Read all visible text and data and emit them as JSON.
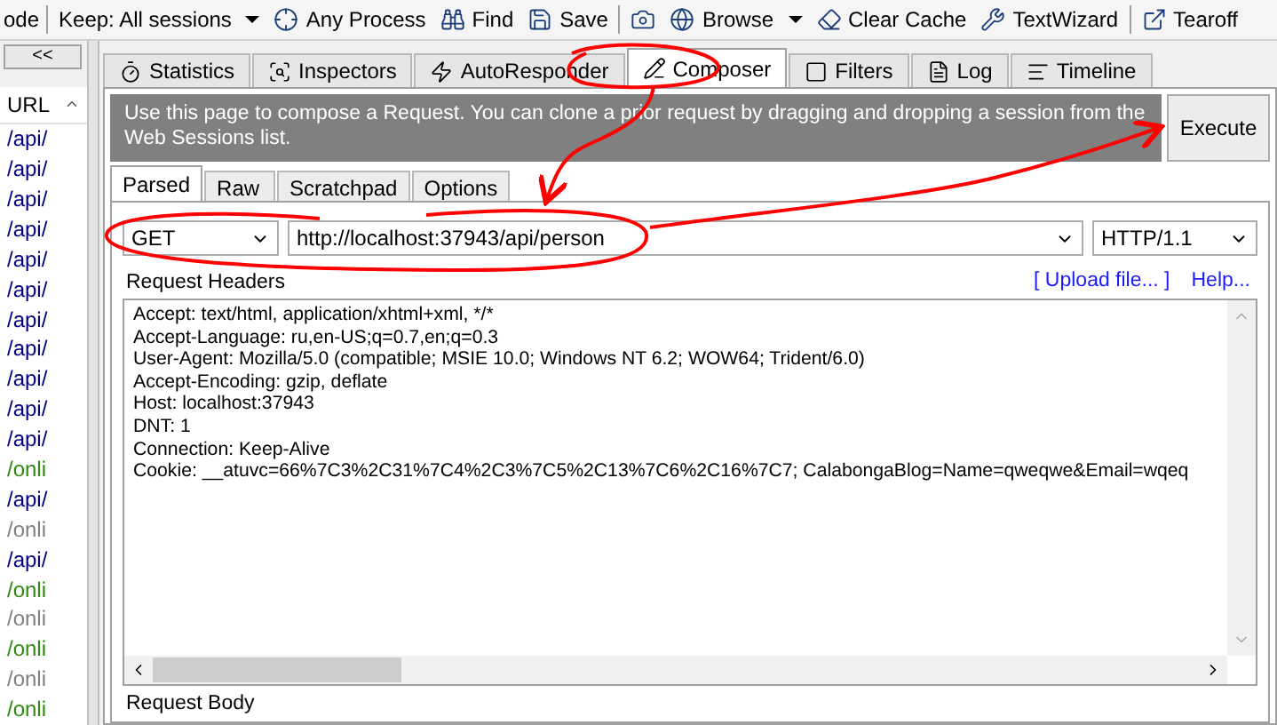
{
  "toolbar": {
    "items": [
      {
        "kind": "text",
        "label": "ode"
      },
      {
        "kind": "separator"
      },
      {
        "kind": "dropdown",
        "label": "Keep: All sessions"
      },
      {
        "kind": "button",
        "label": "Any Process"
      },
      {
        "kind": "button",
        "label": "Find"
      },
      {
        "kind": "button",
        "label": "Save"
      },
      {
        "kind": "separator"
      },
      {
        "kind": "icon-button"
      },
      {
        "kind": "dropdown",
        "label": "Browse"
      },
      {
        "kind": "button",
        "label": "Clear Cache"
      },
      {
        "kind": "button",
        "label": "TextWizard"
      },
      {
        "kind": "separator"
      },
      {
        "kind": "button",
        "label": "Tearoff"
      }
    ]
  },
  "sessions": {
    "collapse_button": "<<",
    "column": "URL",
    "rows": [
      {
        "url": "/api/",
        "color": "#000080"
      },
      {
        "url": "/api/",
        "color": "#000080"
      },
      {
        "url": "/api/",
        "color": "#000080"
      },
      {
        "url": "/api/",
        "color": "#000080"
      },
      {
        "url": "/api/",
        "color": "#000080"
      },
      {
        "url": "/api/",
        "color": "#000080"
      },
      {
        "url": "/api/",
        "color": "#000080"
      },
      {
        "url": "/api/",
        "color": "#000080"
      },
      {
        "url": "/api/",
        "color": "#000080"
      },
      {
        "url": "/api/",
        "color": "#000080"
      },
      {
        "url": "/api/",
        "color": "#000080"
      },
      {
        "url": "/onli",
        "color": "#2e8b10"
      },
      {
        "url": "/api/",
        "color": "#000080"
      },
      {
        "url": "/onli",
        "color": "#808080"
      },
      {
        "url": "/api/",
        "color": "#000080"
      },
      {
        "url": "/onli",
        "color": "#2e8b10"
      },
      {
        "url": "/onli",
        "color": "#808080"
      },
      {
        "url": "/onli",
        "color": "#2e8b10"
      },
      {
        "url": "/onli",
        "color": "#808080"
      },
      {
        "url": "/onli",
        "color": "#2e8b10"
      }
    ]
  },
  "tabs": [
    {
      "label": "Statistics",
      "selected": false
    },
    {
      "label": "Inspectors",
      "selected": false
    },
    {
      "label": "AutoResponder",
      "selected": false
    },
    {
      "label": "Composer",
      "selected": true
    },
    {
      "label": "Filters",
      "selected": false
    },
    {
      "label": "Log",
      "selected": false
    },
    {
      "label": "Timeline",
      "selected": false
    }
  ],
  "composer": {
    "banner": "Use this page to compose a Request. You can clone a prior request by dragging and dropping a session from the Web Sessions list.",
    "execute_button": "Execute",
    "subtabs": [
      {
        "label": "Parsed",
        "selected": true
      },
      {
        "label": "Raw",
        "selected": false
      },
      {
        "label": "Scratchpad",
        "selected": false
      },
      {
        "label": "Options",
        "selected": false
      }
    ],
    "method": "GET",
    "url": "http://localhost:37943/api/person",
    "version": "HTTP/1.1",
    "headers_label": "Request Headers",
    "upload_link": "[ Upload file... ]",
    "help_link": "Help...",
    "headers": [
      "Accept: text/html, application/xhtml+xml, */*",
      "Accept-Language: ru,en-US;q=0.7,en;q=0.3",
      "User-Agent: Mozilla/5.0 (compatible; MSIE 10.0; Windows NT 6.2; WOW64; Trident/6.0)",
      "Accept-Encoding: gzip, deflate",
      "Host: localhost:37943",
      "DNT: 1",
      "Connection: Keep-Alive",
      "Cookie: __atuvc=66%7C3%2C31%7C4%2C3%7C5%2C13%7C6%2C16%7C7; CalabongaBlog=Name=qweqwe&Email=wqeq"
    ],
    "body_label": "Request Body"
  }
}
